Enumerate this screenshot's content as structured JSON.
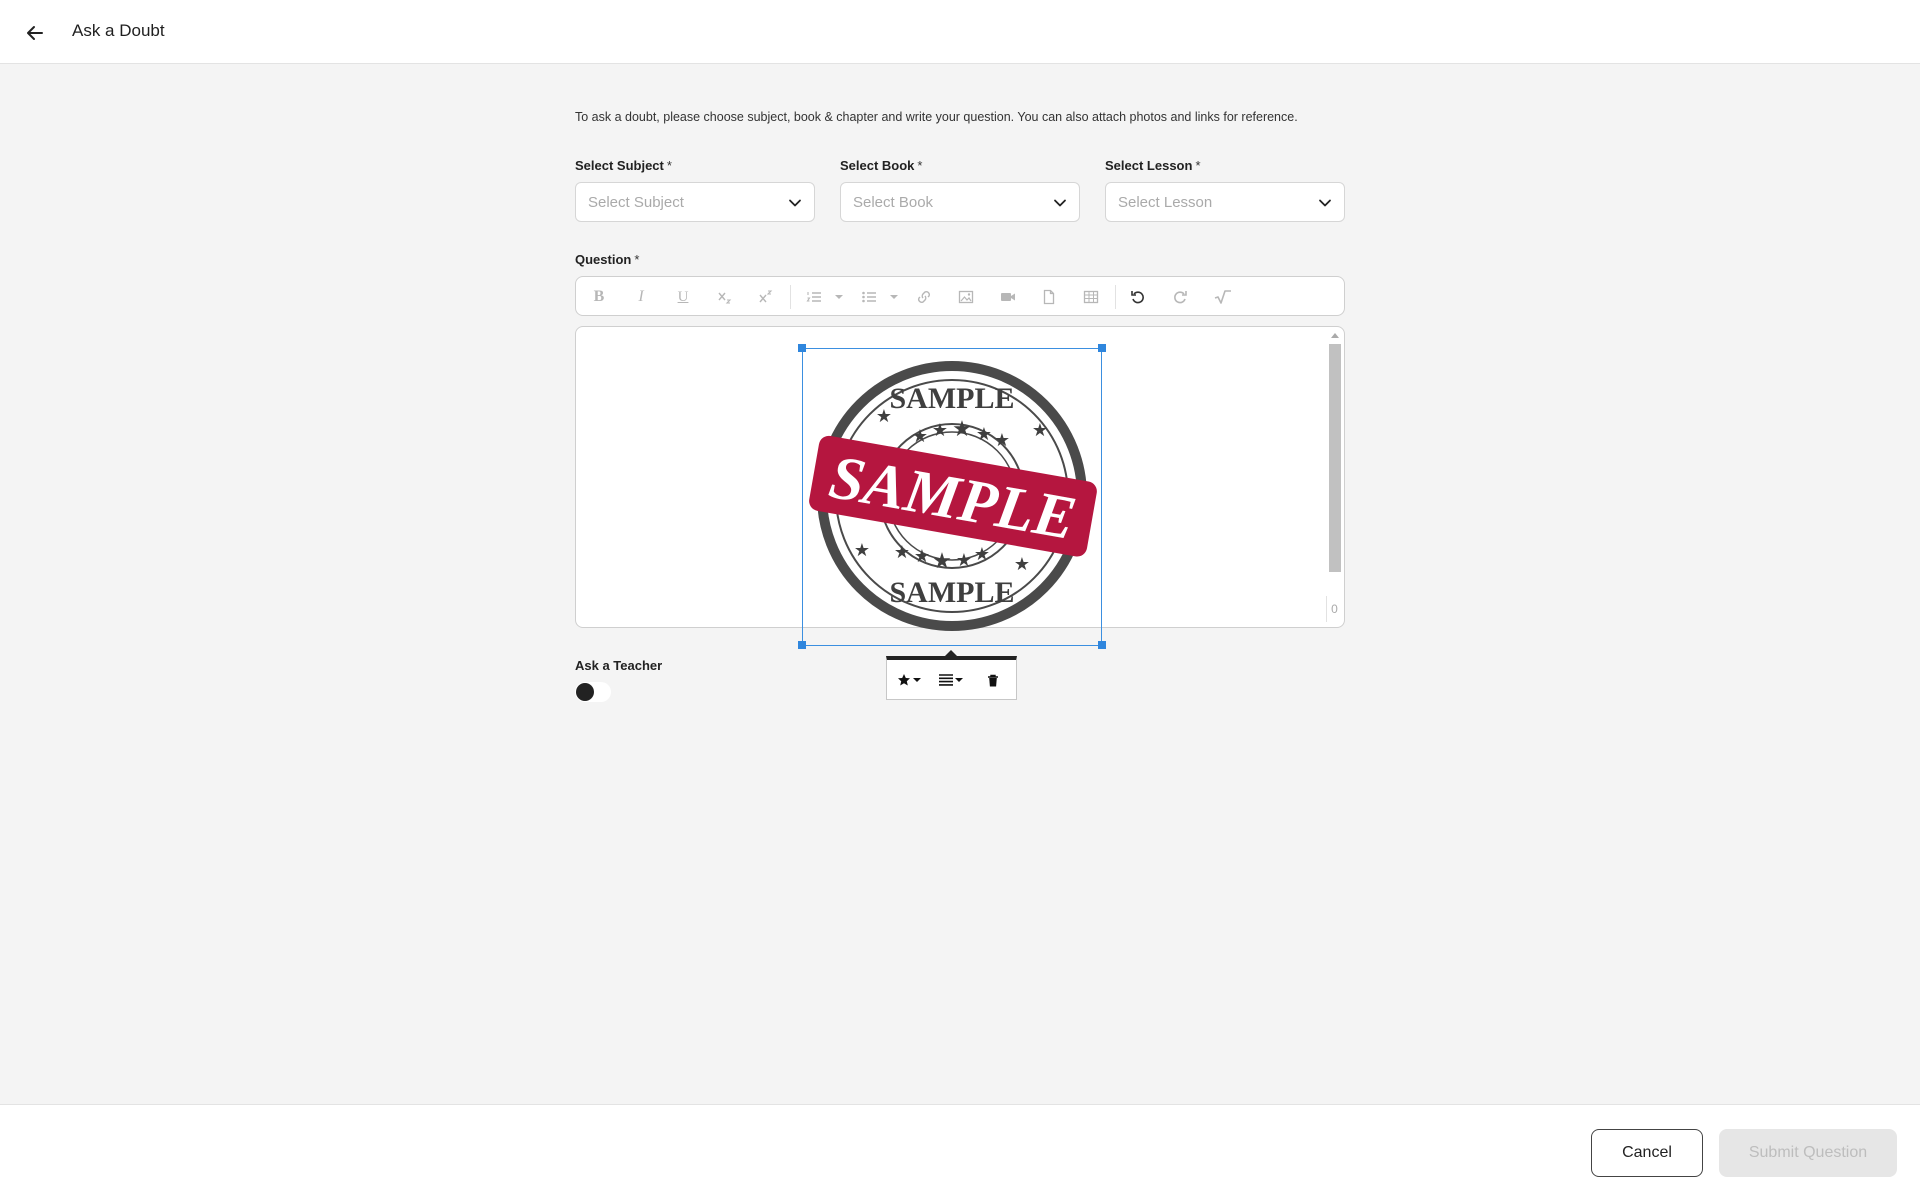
{
  "header": {
    "title": "Ask a Doubt",
    "back_icon": "arrow-left-icon"
  },
  "form": {
    "intro": "To ask a doubt, please choose subject, book & chapter and write your question. You can also attach photos and links for reference.",
    "required_mark": "*",
    "subject": {
      "label": "Select Subject",
      "placeholder": "Select Subject"
    },
    "book": {
      "label": "Select Book",
      "placeholder": "Select Book"
    },
    "lesson": {
      "label": "Select Lesson",
      "placeholder": "Select Lesson"
    },
    "question": {
      "label": "Question"
    }
  },
  "toolbar": {
    "buttons": [
      "bold",
      "italic",
      "underline",
      "subscript",
      "superscript",
      "ordered-list",
      "unordered-list",
      "link",
      "image",
      "video",
      "file",
      "table",
      "undo",
      "redo",
      "math"
    ],
    "bold_label": "B",
    "italic_label": "I",
    "underline_label": "U"
  },
  "editor": {
    "char_count": "0",
    "image": {
      "stamp_text_top": "SAMPLE",
      "stamp_text_center": "SAMPLE",
      "stamp_text_bottom": "SAMPLE",
      "stamp_color": "#b5163f"
    }
  },
  "ask_teacher": {
    "label": "Ask a Teacher",
    "enabled": false
  },
  "footer": {
    "cancel_label": "Cancel",
    "submit_label": "Submit Question"
  },
  "colors": {
    "accent_blue": "#2f86dd",
    "background": "#f4f4f4"
  }
}
